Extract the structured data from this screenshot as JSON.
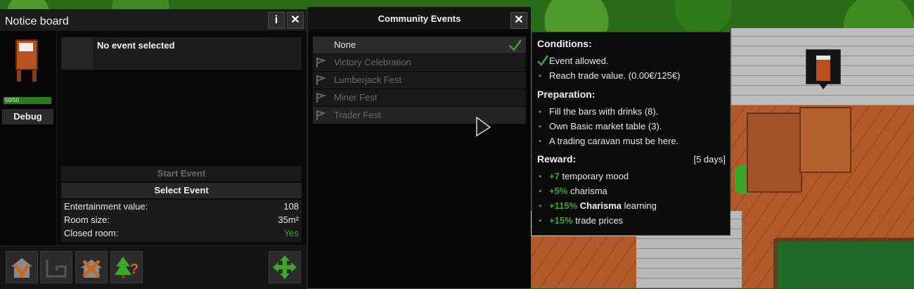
{
  "notice_board": {
    "title": "Notice board",
    "info_label": "i",
    "close_label": "✕",
    "health": "50/50",
    "health_fraction": 1.0,
    "debug_label": "Debug",
    "event_text": "No event selected",
    "start_label": "Start Event",
    "select_label": "Select Event",
    "stats": [
      {
        "label": "Entertainment value:",
        "value": "108"
      },
      {
        "label": "Room size:",
        "value": "35m²"
      },
      {
        "label": "Closed room:",
        "value": "Yes"
      }
    ],
    "toolbar_icons": [
      "build-hammer-icon",
      "room-outline-icon",
      "demolish-icon",
      "tree-question-icon",
      "move-arrows-icon"
    ]
  },
  "community_events": {
    "title": "Community Events",
    "close_label": "✕",
    "items": [
      {
        "label": "None",
        "selected": true
      },
      {
        "label": "Victory Celebration",
        "selected": false
      },
      {
        "label": "Lumberjack Fest",
        "selected": false
      },
      {
        "label": "Miner Fest",
        "selected": false
      },
      {
        "label": "Trader Fest",
        "selected": false
      }
    ]
  },
  "tooltip": {
    "conditions_title": "Conditions:",
    "conditions": [
      "Event allowed.",
      "Reach trade value. (0.00€/125€)"
    ],
    "preparation_title": "Preparation:",
    "preparation": [
      "Fill the bars with drinks (8).",
      "Own Basic market table (3).",
      "A trading caravan must be here."
    ],
    "reward_title": "Reward:",
    "reward_days": "[5 days]",
    "rewards": [
      {
        "amount": "+7",
        "bold": "",
        "text": "temporary mood"
      },
      {
        "amount": "+5%",
        "bold": "",
        "text": "charisma"
      },
      {
        "amount": "+115%",
        "bold": "Charisma",
        "text": "learning"
      },
      {
        "amount": "+15%",
        "bold": "",
        "text": "trade prices"
      }
    ]
  },
  "colors": {
    "accent_green": "#3fa52b",
    "panel_bg": "#0a0a0a",
    "disabled_text": "#6b6b6b"
  }
}
